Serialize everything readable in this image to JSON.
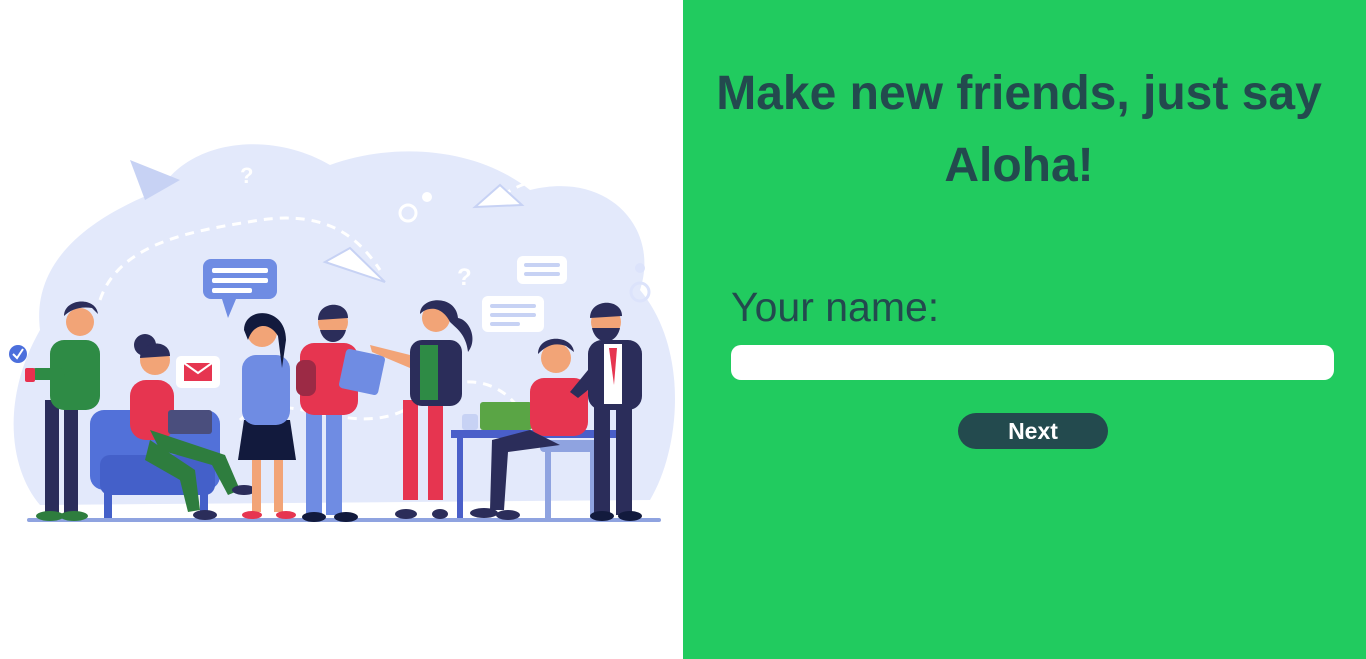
{
  "hero": {
    "headline": "Make new friends, just say Aloha!"
  },
  "form": {
    "name_label": "Your name:",
    "name_value": "",
    "name_placeholder": "",
    "next_label": "Next"
  },
  "colors": {
    "panel_green": "#21cb5f",
    "text_dark": "#234a4e",
    "illustration_bg": "#e3e9fb"
  },
  "illustration": {
    "icons": [
      "paper-plane-icon",
      "speech-bubble-icon",
      "email-icon",
      "checkmark-icon",
      "question-mark-icon",
      "laptop-icon",
      "tablet-icon",
      "phone-icon"
    ]
  }
}
